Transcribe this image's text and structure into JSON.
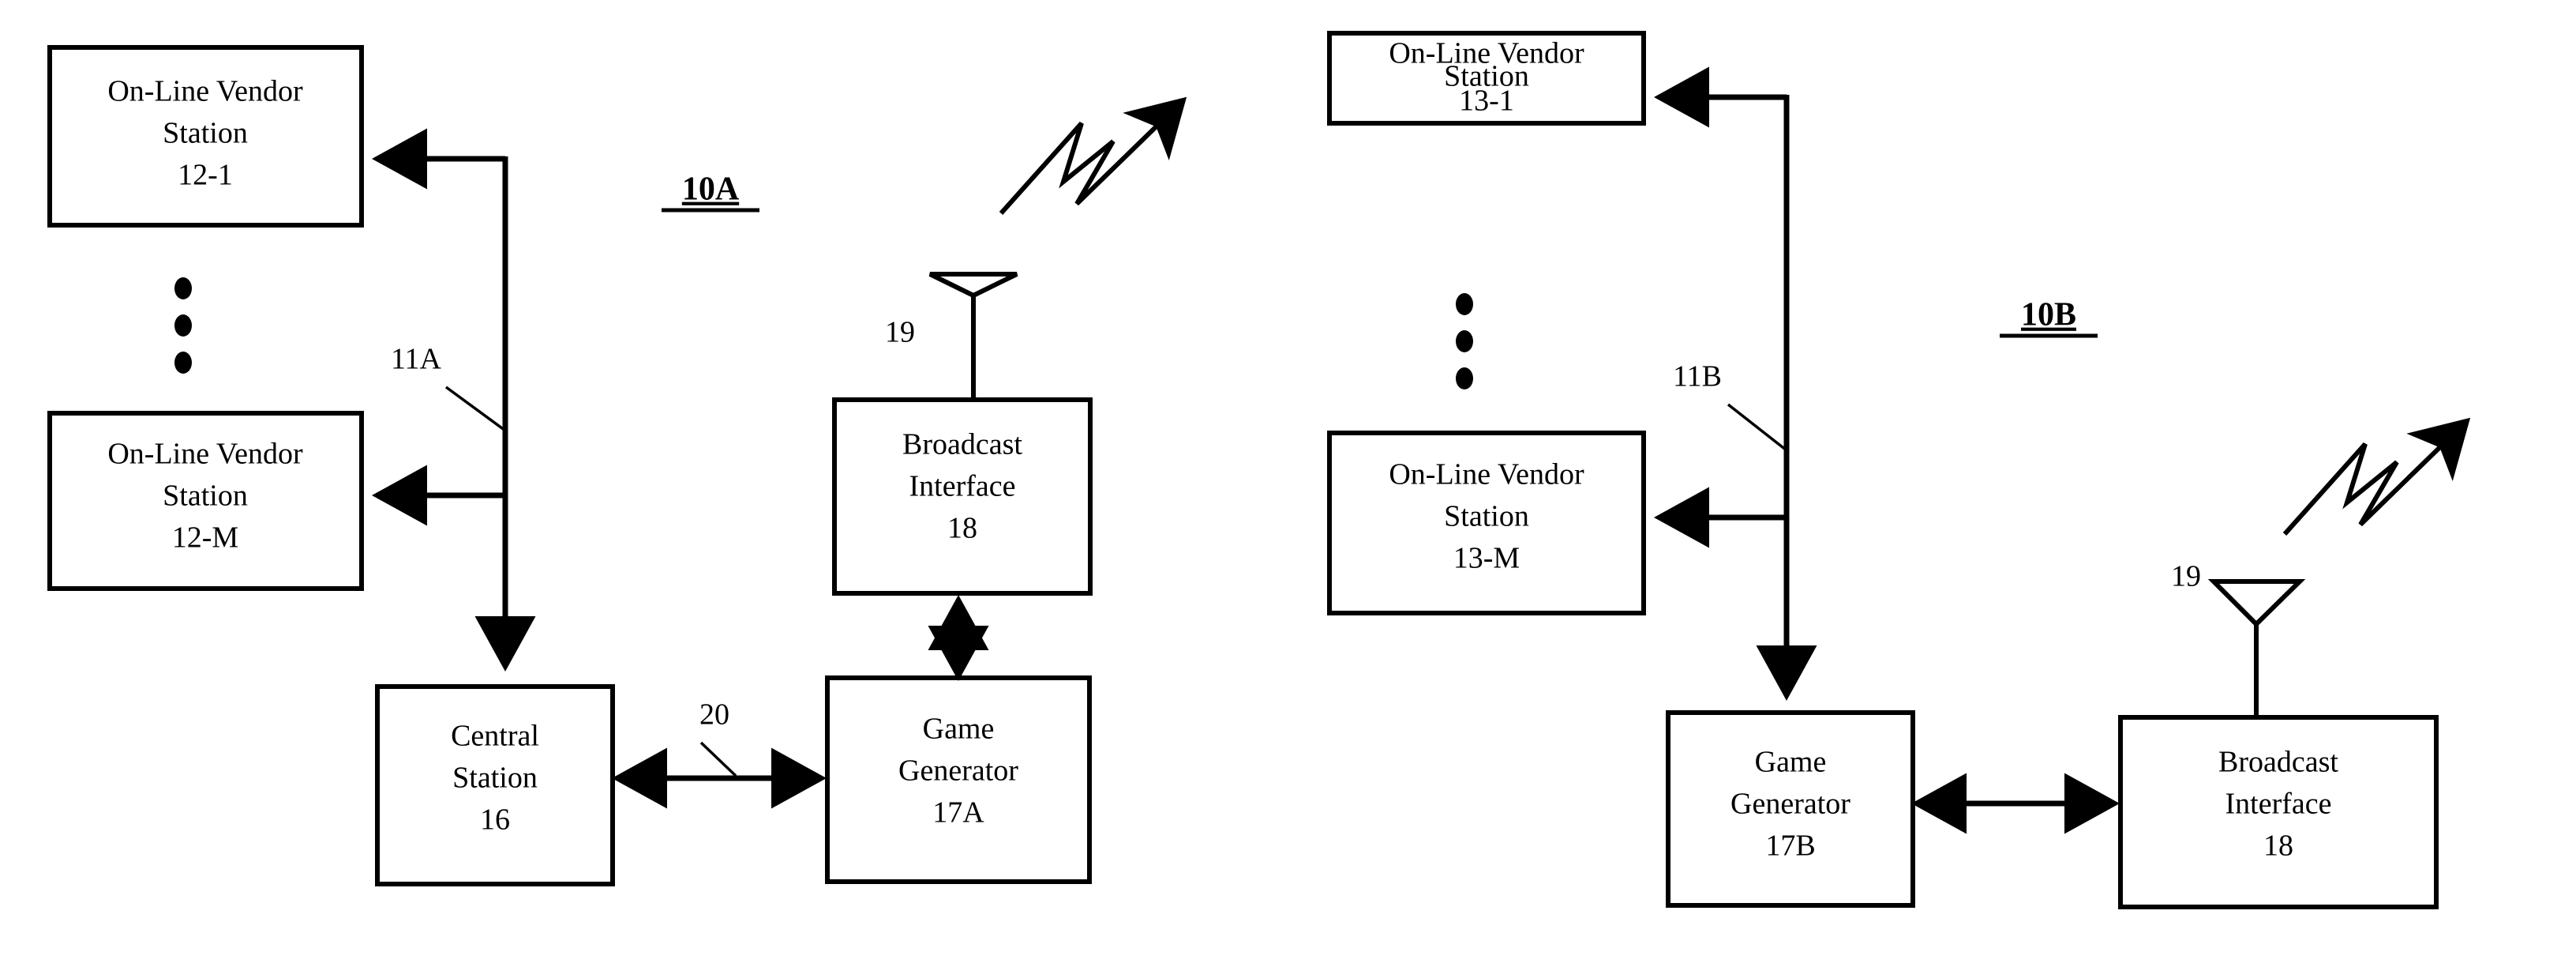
{
  "figure": {
    "title_left": "10A",
    "title_right": "10B"
  },
  "left_panel": {
    "vendor_top": {
      "line1": "On-Line Vendor",
      "line2": "Station",
      "line3": "12-1"
    },
    "vendor_bottom": {
      "line1": "On-Line Vendor",
      "line2": "Station",
      "line3": "12-M"
    },
    "central_station": {
      "line1": "Central",
      "line2": "Station",
      "line3": "16"
    },
    "game_generator": {
      "line1": "Game",
      "line2": "Generator",
      "line3": "17A"
    },
    "broadcast_interface": {
      "line1": "Broadcast",
      "line2": "Interface",
      "line3": "18"
    },
    "bus_label": "11A",
    "link_label": "20",
    "antenna_label": "19"
  },
  "right_panel": {
    "vendor_top": {
      "line1": "On-Line Vendor",
      "line2": "Station",
      "line3": "13-1"
    },
    "vendor_bottom": {
      "line1": "On-Line Vendor",
      "line2": "Station",
      "line3": "13-M"
    },
    "game_generator": {
      "line1": "Game",
      "line2": "Generator",
      "line3": "17B"
    },
    "broadcast_interface": {
      "line1": "Broadcast",
      "line2": "Interface",
      "line3": "18"
    },
    "bus_label": "11B",
    "antenna_label": "19"
  },
  "colors": {
    "stroke": "#000000",
    "background": "#ffffff"
  }
}
